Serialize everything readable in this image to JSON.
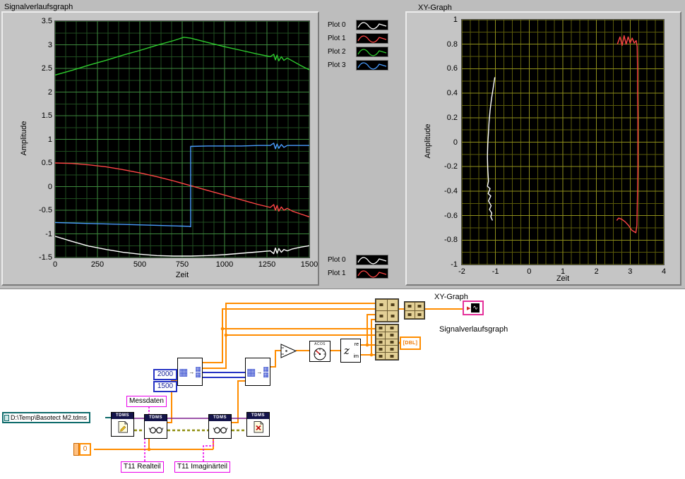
{
  "front_panel": {
    "waveform_graph": {
      "title": "Signalverlaufsgraph",
      "xlabel": "Zeit",
      "ylabel": "Amplitude",
      "legend": [
        {
          "label": "Plot 0",
          "color": "#ffffff"
        },
        {
          "label": "Plot 1",
          "color": "#ff4545"
        },
        {
          "label": "Plot 2",
          "color": "#2ecc2e"
        },
        {
          "label": "Plot 3",
          "color": "#4a9dff"
        }
      ]
    },
    "xy_graph": {
      "title": "XY-Graph",
      "xlabel": "Zeit",
      "ylabel": "Amplitude",
      "legend": [
        {
          "label": "Plot 0",
          "color": "#ffffff"
        },
        {
          "label": "Plot 1",
          "color": "#ff4545"
        }
      ]
    }
  },
  "chart_data": [
    {
      "type": "line",
      "title": "Signalverlaufsgraph",
      "xlabel": "Zeit",
      "ylabel": "Amplitude",
      "xlim": [
        0,
        1500
      ],
      "ylim": [
        -1.5,
        3.5
      ],
      "xticks": [
        0,
        250,
        500,
        750,
        1000,
        1250,
        1500
      ],
      "xticklabels": [
        "0",
        "250",
        "500",
        "750",
        "1000",
        "1250",
        "1500"
      ],
      "yticks": [
        3.5,
        3,
        2.5,
        2,
        1.5,
        1,
        0.5,
        0,
        -0.5,
        -1,
        -1.5
      ],
      "yticklabels": [
        "3.5",
        "3",
        "2.5",
        "2",
        "1.5",
        "1",
        "0.5",
        "0",
        "-0.5",
        "-1",
        "-1.5"
      ],
      "grid": {
        "minor_x": 62.5,
        "minor_y": 0.25,
        "minor_color": "#1f4d1f",
        "major_color": "#3e8a3e"
      },
      "background": "#000000",
      "legend_position": "top-right-outside",
      "series": [
        {
          "name": "Plot 0",
          "color": "#ffffff",
          "points": [
            [
              0,
              -1.05
            ],
            [
              100,
              -1.16
            ],
            [
              200,
              -1.26
            ],
            [
              300,
              -1.33
            ],
            [
              400,
              -1.39
            ],
            [
              500,
              -1.43
            ],
            [
              600,
              -1.46
            ],
            [
              700,
              -1.47
            ],
            [
              800,
              -1.47
            ],
            [
              900,
              -1.46
            ],
            [
              1000,
              -1.44
            ],
            [
              1100,
              -1.41
            ],
            [
              1200,
              -1.38
            ],
            [
              1270,
              -1.36
            ],
            [
              1290,
              -1.42
            ],
            [
              1300,
              -1.3
            ],
            [
              1310,
              -1.41
            ],
            [
              1320,
              -1.31
            ],
            [
              1335,
              -1.39
            ],
            [
              1350,
              -1.33
            ],
            [
              1370,
              -1.36
            ],
            [
              1400,
              -1.32
            ],
            [
              1450,
              -1.28
            ],
            [
              1500,
              -1.25
            ]
          ]
        },
        {
          "name": "Plot 1",
          "color": "#ff4545",
          "points": [
            [
              0,
              0.5
            ],
            [
              100,
              0.49
            ],
            [
              200,
              0.46
            ],
            [
              300,
              0.42
            ],
            [
              400,
              0.36
            ],
            [
              500,
              0.29
            ],
            [
              600,
              0.21
            ],
            [
              700,
              0.12
            ],
            [
              800,
              0.02
            ],
            [
              900,
              -0.08
            ],
            [
              1000,
              -0.18
            ],
            [
              1100,
              -0.28
            ],
            [
              1200,
              -0.38
            ],
            [
              1270,
              -0.44
            ],
            [
              1290,
              -0.38
            ],
            [
              1300,
              -0.5
            ],
            [
              1310,
              -0.4
            ],
            [
              1320,
              -0.52
            ],
            [
              1335,
              -0.43
            ],
            [
              1350,
              -0.5
            ],
            [
              1370,
              -0.46
            ],
            [
              1400,
              -0.52
            ],
            [
              1450,
              -0.58
            ],
            [
              1500,
              -0.64
            ]
          ]
        },
        {
          "name": "Plot 2",
          "color": "#2ecc2e",
          "points": [
            [
              0,
              2.36
            ],
            [
              100,
              2.46
            ],
            [
              200,
              2.57
            ],
            [
              300,
              2.67
            ],
            [
              400,
              2.78
            ],
            [
              500,
              2.88
            ],
            [
              600,
              2.99
            ],
            [
              700,
              3.09
            ],
            [
              760,
              3.16
            ],
            [
              800,
              3.14
            ],
            [
              900,
              3.05
            ],
            [
              1000,
              2.96
            ],
            [
              1100,
              2.88
            ],
            [
              1200,
              2.8
            ],
            [
              1270,
              2.75
            ],
            [
              1290,
              2.8
            ],
            [
              1300,
              2.68
            ],
            [
              1310,
              2.78
            ],
            [
              1320,
              2.66
            ],
            [
              1335,
              2.75
            ],
            [
              1350,
              2.67
            ],
            [
              1370,
              2.72
            ],
            [
              1400,
              2.66
            ],
            [
              1450,
              2.56
            ],
            [
              1500,
              2.47
            ]
          ]
        },
        {
          "name": "Plot 3",
          "color": "#4a9dff",
          "points": [
            [
              0,
              -0.76
            ],
            [
              200,
              -0.78
            ],
            [
              400,
              -0.8
            ],
            [
              600,
              -0.82
            ],
            [
              790,
              -0.84
            ],
            [
              800,
              -0.85
            ],
            [
              800,
              0.85
            ],
            [
              900,
              0.86
            ],
            [
              1000,
              0.86
            ],
            [
              1100,
              0.86
            ],
            [
              1200,
              0.87
            ],
            [
              1270,
              0.87
            ],
            [
              1290,
              0.92
            ],
            [
              1300,
              0.8
            ],
            [
              1310,
              0.9
            ],
            [
              1320,
              0.81
            ],
            [
              1335,
              0.89
            ],
            [
              1350,
              0.83
            ],
            [
              1370,
              0.87
            ],
            [
              1400,
              0.87
            ],
            [
              1450,
              0.87
            ],
            [
              1500,
              0.87
            ]
          ]
        }
      ]
    },
    {
      "type": "line",
      "title": "XY-Graph",
      "xlabel": "Zeit",
      "ylabel": "Amplitude",
      "xlim": [
        -2,
        4
      ],
      "ylim": [
        -1,
        1
      ],
      "xticks": [
        -2,
        -1,
        0,
        1,
        2,
        3,
        4
      ],
      "xticklabels": [
        "-2",
        "-1",
        "0",
        "1",
        "2",
        "3",
        "4"
      ],
      "yticks": [
        1,
        0.8,
        0.6,
        0.4,
        0.2,
        0,
        -0.2,
        -0.4,
        -0.6,
        -0.8,
        -1
      ],
      "yticklabels": [
        "1",
        "0.8",
        "0.6",
        "0.4",
        "0.2",
        "0",
        "-0.2",
        "-0.4",
        "-0.6",
        "-0.8",
        "-1"
      ],
      "grid": {
        "minor_x": 0.25,
        "minor_y": 0.1,
        "minor_color": "#5a5a0a",
        "major_color": "#90901c"
      },
      "background": "#000000",
      "legend_position": "bottom-left-outside",
      "series": [
        {
          "name": "Plot 0",
          "color": "#ffffff",
          "points": [
            [
              -1.02,
              0.53
            ],
            [
              -1.07,
              0.44
            ],
            [
              -1.12,
              0.35
            ],
            [
              -1.16,
              0.26
            ],
            [
              -1.19,
              0.17
            ],
            [
              -1.21,
              0.08
            ],
            [
              -1.23,
              -0.02
            ],
            [
              -1.24,
              -0.12
            ],
            [
              -1.23,
              -0.22
            ],
            [
              -1.21,
              -0.32
            ],
            [
              -1.24,
              -0.36
            ],
            [
              -1.16,
              -0.38
            ],
            [
              -1.22,
              -0.42
            ],
            [
              -1.14,
              -0.44
            ],
            [
              -1.21,
              -0.48
            ],
            [
              -1.13,
              -0.52
            ],
            [
              -1.18,
              -0.55
            ],
            [
              -1.11,
              -0.58
            ],
            [
              -1.14,
              -0.61
            ],
            [
              -1.09,
              -0.64
            ]
          ]
        },
        {
          "name": "Plot 1",
          "color": "#ff4545",
          "points": [
            [
              2.62,
              0.8
            ],
            [
              2.7,
              0.86
            ],
            [
              2.76,
              0.79
            ],
            [
              2.82,
              0.87
            ],
            [
              2.88,
              0.8
            ],
            [
              2.94,
              0.86
            ],
            [
              3.0,
              0.81
            ],
            [
              3.06,
              0.85
            ],
            [
              3.12,
              0.81
            ],
            [
              3.18,
              0.83
            ],
            [
              3.21,
              0.78
            ],
            [
              3.22,
              0.6
            ],
            [
              3.22,
              0.4
            ],
            [
              3.23,
              0.2
            ],
            [
              3.23,
              0.0
            ],
            [
              3.23,
              -0.2
            ],
            [
              3.22,
              -0.4
            ],
            [
              3.21,
              -0.55
            ],
            [
              3.2,
              -0.68
            ],
            [
              3.17,
              -0.74
            ],
            [
              3.05,
              -0.72
            ],
            [
              2.95,
              -0.68
            ],
            [
              2.85,
              -0.65
            ],
            [
              2.75,
              -0.63
            ],
            [
              2.66,
              -0.62
            ],
            [
              2.6,
              -0.64
            ]
          ]
        }
      ]
    }
  ],
  "block_diagram": {
    "xy_graph_label": "XY-Graph",
    "waveform_graph_label": "Signalverlaufsgraph",
    "dbl_terminal_label": "[DBL]",
    "acos_label": "ACOS",
    "z_node": {
      "main": "z",
      "out_top": "re",
      "out_bottom": "im"
    },
    "constants": {
      "rows": "2000",
      "cols": "1500",
      "index": "0"
    },
    "string_constants": {
      "group": "Messdaten",
      "channel_real": "T11 Realteil",
      "channel_imag": "T11 Imaginärteil"
    },
    "path_constant": "D:\\Temp\\Basotect M2.tdms",
    "tdms_label": "TDMS"
  }
}
